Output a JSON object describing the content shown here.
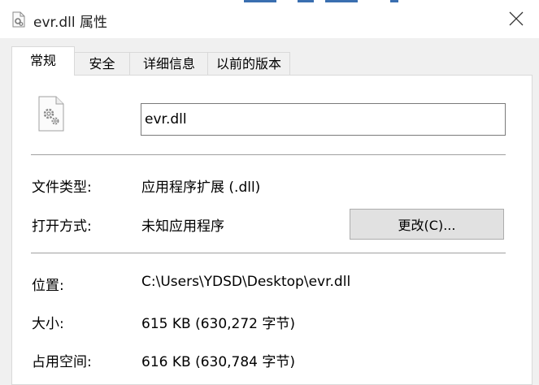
{
  "window": {
    "title": "evr.dll 属性",
    "icon": "dll-file-icon",
    "close_icon": "close-icon"
  },
  "tabs": [
    {
      "label": "常规",
      "active": true
    },
    {
      "label": "安全",
      "active": false
    },
    {
      "label": "详细信息",
      "active": false
    },
    {
      "label": "以前的版本",
      "active": false
    }
  ],
  "general": {
    "file_name": "evr.dll",
    "file_type_label": "文件类型:",
    "file_type_value": "应用程序扩展 (.dll)",
    "open_with_label": "打开方式:",
    "open_with_value": "未知应用程序",
    "change_button": "更改(C)...",
    "location_label": "位置:",
    "location_value": "C:\\Users\\YDSD\\Desktop\\evr.dll",
    "size_label": "大小:",
    "size_value": "615 KB (630,272 字节)",
    "disk_size_label": "占用空间:",
    "disk_size_value": "616 KB (630,784 字节)"
  },
  "colors": {
    "accent": "#3a6fb0",
    "panel_bg": "#ffffff",
    "dialog_bg": "#f0f0f0",
    "button_bg": "#e1e1e1"
  }
}
